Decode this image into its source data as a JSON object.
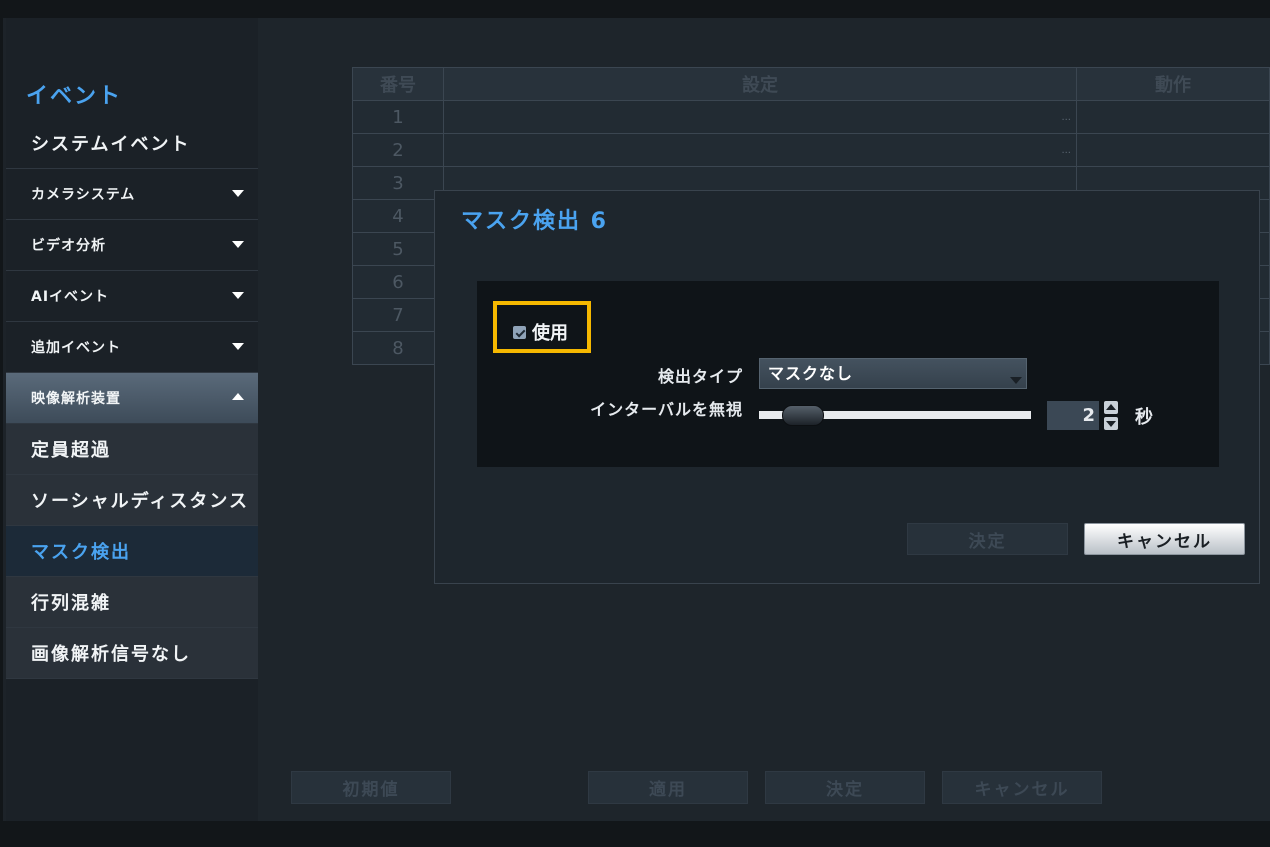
{
  "sidebar": {
    "title": "イベント",
    "items": [
      {
        "label": "システムイベント"
      },
      {
        "label": "カメラシステム"
      },
      {
        "label": "ビデオ分析"
      },
      {
        "label": "AIイベント"
      },
      {
        "label": "追加イベント"
      },
      {
        "label": "映像解析装置"
      },
      {
        "label": "定員超過"
      },
      {
        "label": "ソーシャルディスタンス"
      },
      {
        "label": "マスク検出"
      },
      {
        "label": "行列混雑"
      },
      {
        "label": "画像解析信号なし"
      }
    ]
  },
  "table": {
    "headers": [
      "番号",
      "設定",
      "動作"
    ],
    "rows": [
      "1",
      "2",
      "3",
      "4",
      "5",
      "6",
      "7",
      "8"
    ],
    "dots": "..."
  },
  "bottom_buttons": {
    "default": "初期値",
    "apply": "適用",
    "ok": "決定",
    "cancel": "キャンセル"
  },
  "dialog": {
    "title": "マスク検出 6",
    "use_label": "使用",
    "use_checked": true,
    "detect_type_label": "検出タイプ",
    "detect_type_value": "マスクなし",
    "ignore_interval_label": "インターバルを無視",
    "interval_value": "2",
    "interval_unit": "秒",
    "ok_label": "決定",
    "cancel_label": "キャンセル"
  },
  "colors": {
    "accent": "#4aa3f0",
    "highlight": "#f5b800"
  }
}
